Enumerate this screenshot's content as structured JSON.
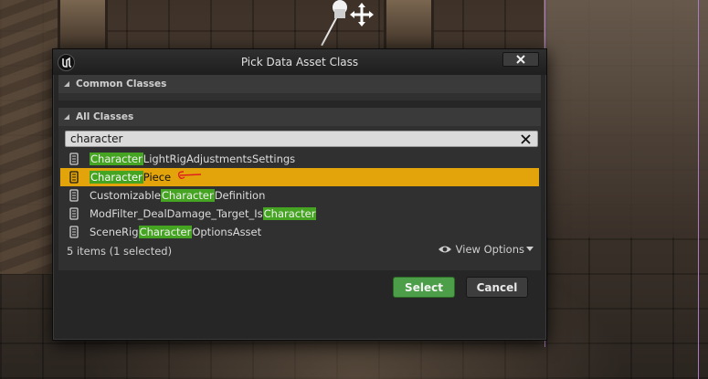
{
  "dialog": {
    "title": "Pick Data Asset Class",
    "close_icon": "close-icon",
    "logo_icon": "unreal-logo-icon"
  },
  "common_classes": {
    "label": "Common Classes",
    "expanded": true
  },
  "all_classes": {
    "label": "All Classes",
    "expanded": true
  },
  "search": {
    "value": "character",
    "clear_icon": "clear-search-icon"
  },
  "results": [
    {
      "pre": "",
      "match": "Character",
      "post": "LightRigAdjustmentsSettings",
      "selected": false
    },
    {
      "pre": "",
      "match": "Character",
      "post": "Piece",
      "selected": true,
      "annotated": true
    },
    {
      "pre": "Customizable",
      "match": "Character",
      "post": "Definition",
      "selected": false
    },
    {
      "pre": "ModFilter_DealDamage_Target_Is",
      "match": "Character",
      "post": "",
      "selected": false
    },
    {
      "pre": "SceneRig",
      "match": "Character",
      "post": "OptionsAsset",
      "selected": false
    }
  ],
  "status": {
    "count_text": "5 items (1 selected)",
    "view_options_label": "View Options"
  },
  "buttons": {
    "select_label": "Select",
    "cancel_label": "Cancel"
  },
  "colors": {
    "selected_row": "#e2a40a",
    "match_highlight": "#45a522",
    "select_button": "#4c9f48",
    "annotation": "#e02020"
  }
}
